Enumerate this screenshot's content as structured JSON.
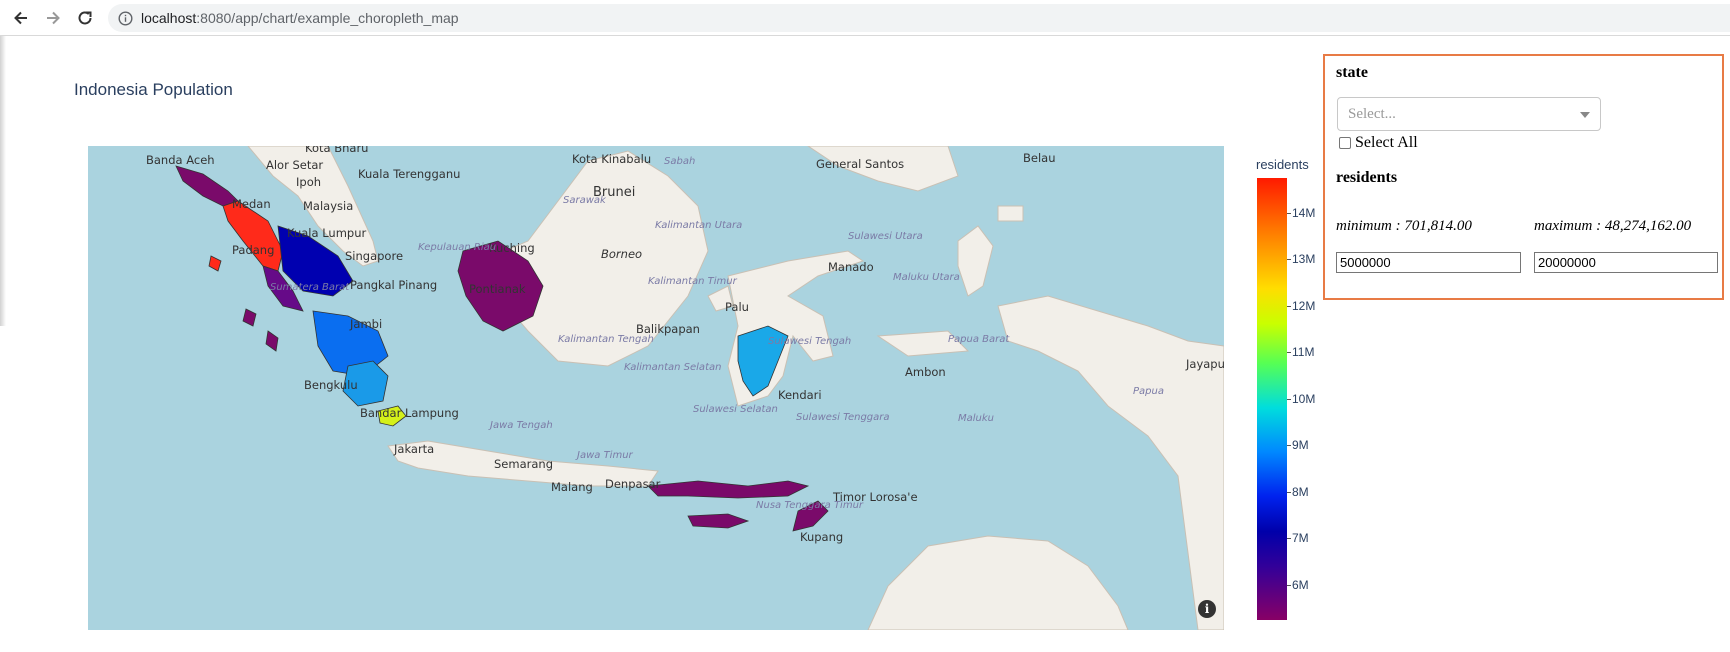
{
  "browser": {
    "url_host": "localhost",
    "url_path": ":8080/app/chart/example_choropleth_map"
  },
  "chart": {
    "title": "Indonesia Population",
    "colorbar_title": "residents",
    "colorbar_ticks": [
      "14M",
      "13M",
      "12M",
      "11M",
      "10M",
      "9M",
      "8M",
      "7M",
      "6M"
    ]
  },
  "map": {
    "cities": [
      "Banda Aceh",
      "Kota Bharu",
      "Alor Setar",
      "Ipoh",
      "Kuala Terengganu",
      "Malaysia",
      "Kuala Lumpur",
      "Singapore",
      "Pangkal Pinang",
      "Jambi",
      "Bengkulu",
      "Bandar Lampung",
      "Jakarta",
      "Semarang",
      "Malang",
      "Denpasar",
      "Kota Kinabalu",
      "Brunei",
      "Kuching",
      "Pontianak",
      "Borneo",
      "Balikpapan",
      "Palu",
      "Kendari",
      "Manado",
      "General Santos",
      "Ambon",
      "Kupang",
      "Timor Lorosa'e",
      "Jayapura",
      "Belau",
      "Medan",
      "Padang"
    ],
    "regions": [
      "Sabah",
      "Sarawak",
      "Kepulauan Riau",
      "Sumatera Barat",
      "Kalimantan Utara",
      "Kalimantan Timur",
      "Kalimantan Tengah",
      "Kalimantan Selatan",
      "Sulawesi Utara",
      "Sulawesi Tengah",
      "Maluku Utara",
      "Sulawesi Selatan",
      "Sulawesi Tenggara",
      "Papua Barat",
      "Papua",
      "Maluku",
      "Jawa Tengah",
      "Jawa Timur",
      "Nusa Tenggara Timur"
    ],
    "info_icon": "info-icon"
  },
  "filters": {
    "state_label": "state",
    "state_placeholder": "Select...",
    "select_all_label": "Select All",
    "residents_label": "residents",
    "minimum_text": "minimum : 701,814.00",
    "maximum_text": "maximum : 48,274,162.00",
    "min_value": "5000000",
    "max_value": "20000000"
  },
  "chart_data": {
    "type": "choropleth",
    "title": "Indonesia Population",
    "colorbar_title": "residents",
    "colorbar_range": [
      5300000,
      14800000
    ],
    "colorbar_ticks": [
      "6M",
      "7M",
      "8M",
      "9M",
      "10M",
      "11M",
      "12M",
      "13M",
      "14M"
    ],
    "colorscale": [
      "#880066",
      "#330099",
      "#0000aa",
      "#0022ee",
      "#0088ff",
      "#00dddd",
      "#55ff55",
      "#c9ff00",
      "#ffdd00",
      "#ff7a00",
      "#ff1a00"
    ]
  }
}
